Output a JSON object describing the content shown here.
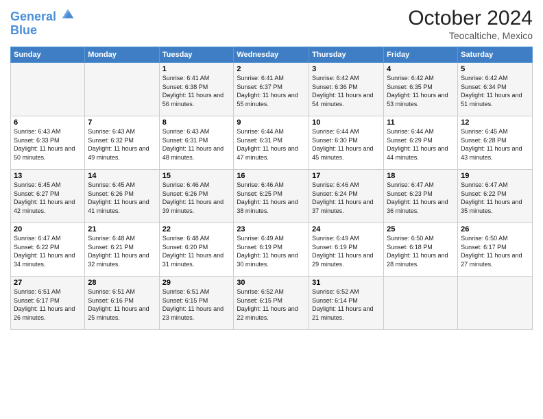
{
  "header": {
    "logo_line1": "General",
    "logo_line2": "Blue",
    "month": "October 2024",
    "location": "Teocaltiche, Mexico"
  },
  "days_of_week": [
    "Sunday",
    "Monday",
    "Tuesday",
    "Wednesday",
    "Thursday",
    "Friday",
    "Saturday"
  ],
  "weeks": [
    [
      {
        "day": "",
        "info": ""
      },
      {
        "day": "",
        "info": ""
      },
      {
        "day": "1",
        "info": "Sunrise: 6:41 AM\nSunset: 6:38 PM\nDaylight: 11 hours and 56 minutes."
      },
      {
        "day": "2",
        "info": "Sunrise: 6:41 AM\nSunset: 6:37 PM\nDaylight: 11 hours and 55 minutes."
      },
      {
        "day": "3",
        "info": "Sunrise: 6:42 AM\nSunset: 6:36 PM\nDaylight: 11 hours and 54 minutes."
      },
      {
        "day": "4",
        "info": "Sunrise: 6:42 AM\nSunset: 6:35 PM\nDaylight: 11 hours and 53 minutes."
      },
      {
        "day": "5",
        "info": "Sunrise: 6:42 AM\nSunset: 6:34 PM\nDaylight: 11 hours and 51 minutes."
      }
    ],
    [
      {
        "day": "6",
        "info": "Sunrise: 6:43 AM\nSunset: 6:33 PM\nDaylight: 11 hours and 50 minutes."
      },
      {
        "day": "7",
        "info": "Sunrise: 6:43 AM\nSunset: 6:32 PM\nDaylight: 11 hours and 49 minutes."
      },
      {
        "day": "8",
        "info": "Sunrise: 6:43 AM\nSunset: 6:31 PM\nDaylight: 11 hours and 48 minutes."
      },
      {
        "day": "9",
        "info": "Sunrise: 6:44 AM\nSunset: 6:31 PM\nDaylight: 11 hours and 47 minutes."
      },
      {
        "day": "10",
        "info": "Sunrise: 6:44 AM\nSunset: 6:30 PM\nDaylight: 11 hours and 45 minutes."
      },
      {
        "day": "11",
        "info": "Sunrise: 6:44 AM\nSunset: 6:29 PM\nDaylight: 11 hours and 44 minutes."
      },
      {
        "day": "12",
        "info": "Sunrise: 6:45 AM\nSunset: 6:28 PM\nDaylight: 11 hours and 43 minutes."
      }
    ],
    [
      {
        "day": "13",
        "info": "Sunrise: 6:45 AM\nSunset: 6:27 PM\nDaylight: 11 hours and 42 minutes."
      },
      {
        "day": "14",
        "info": "Sunrise: 6:45 AM\nSunset: 6:26 PM\nDaylight: 11 hours and 41 minutes."
      },
      {
        "day": "15",
        "info": "Sunrise: 6:46 AM\nSunset: 6:26 PM\nDaylight: 11 hours and 39 minutes."
      },
      {
        "day": "16",
        "info": "Sunrise: 6:46 AM\nSunset: 6:25 PM\nDaylight: 11 hours and 38 minutes."
      },
      {
        "day": "17",
        "info": "Sunrise: 6:46 AM\nSunset: 6:24 PM\nDaylight: 11 hours and 37 minutes."
      },
      {
        "day": "18",
        "info": "Sunrise: 6:47 AM\nSunset: 6:23 PM\nDaylight: 11 hours and 36 minutes."
      },
      {
        "day": "19",
        "info": "Sunrise: 6:47 AM\nSunset: 6:22 PM\nDaylight: 11 hours and 35 minutes."
      }
    ],
    [
      {
        "day": "20",
        "info": "Sunrise: 6:47 AM\nSunset: 6:22 PM\nDaylight: 11 hours and 34 minutes."
      },
      {
        "day": "21",
        "info": "Sunrise: 6:48 AM\nSunset: 6:21 PM\nDaylight: 11 hours and 32 minutes."
      },
      {
        "day": "22",
        "info": "Sunrise: 6:48 AM\nSunset: 6:20 PM\nDaylight: 11 hours and 31 minutes."
      },
      {
        "day": "23",
        "info": "Sunrise: 6:49 AM\nSunset: 6:19 PM\nDaylight: 11 hours and 30 minutes."
      },
      {
        "day": "24",
        "info": "Sunrise: 6:49 AM\nSunset: 6:19 PM\nDaylight: 11 hours and 29 minutes."
      },
      {
        "day": "25",
        "info": "Sunrise: 6:50 AM\nSunset: 6:18 PM\nDaylight: 11 hours and 28 minutes."
      },
      {
        "day": "26",
        "info": "Sunrise: 6:50 AM\nSunset: 6:17 PM\nDaylight: 11 hours and 27 minutes."
      }
    ],
    [
      {
        "day": "27",
        "info": "Sunrise: 6:51 AM\nSunset: 6:17 PM\nDaylight: 11 hours and 26 minutes."
      },
      {
        "day": "28",
        "info": "Sunrise: 6:51 AM\nSunset: 6:16 PM\nDaylight: 11 hours and 25 minutes."
      },
      {
        "day": "29",
        "info": "Sunrise: 6:51 AM\nSunset: 6:15 PM\nDaylight: 11 hours and 23 minutes."
      },
      {
        "day": "30",
        "info": "Sunrise: 6:52 AM\nSunset: 6:15 PM\nDaylight: 11 hours and 22 minutes."
      },
      {
        "day": "31",
        "info": "Sunrise: 6:52 AM\nSunset: 6:14 PM\nDaylight: 11 hours and 21 minutes."
      },
      {
        "day": "",
        "info": ""
      },
      {
        "day": "",
        "info": ""
      }
    ]
  ]
}
